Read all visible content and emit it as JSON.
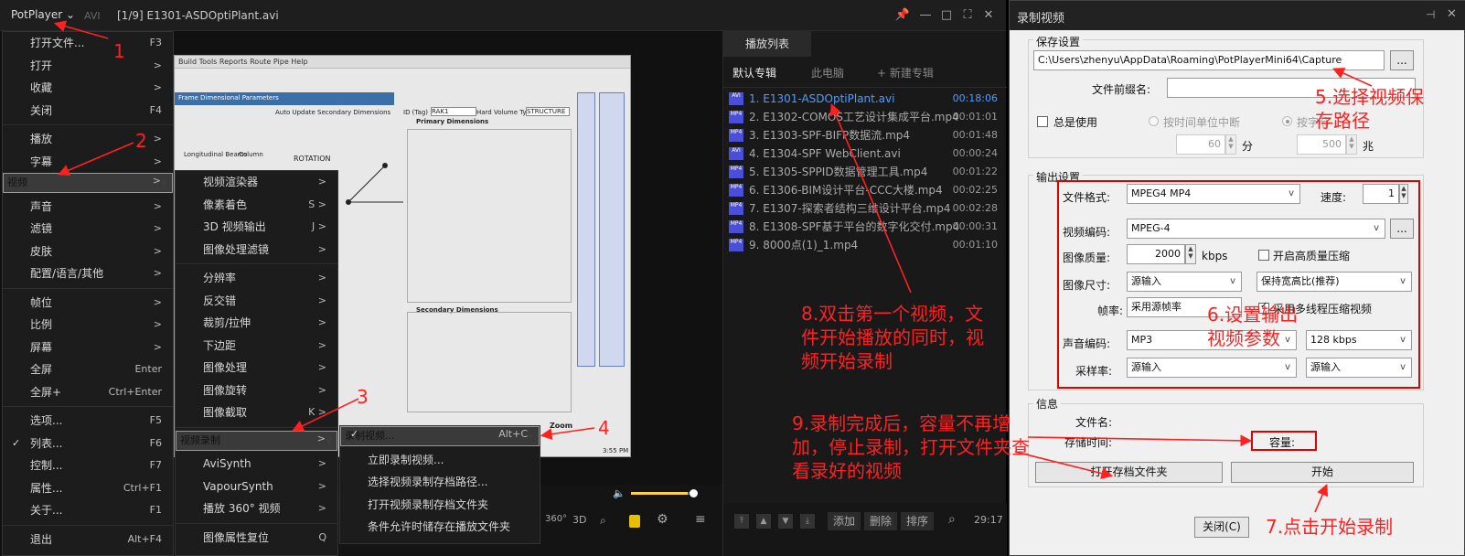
{
  "titlebar": {
    "brand": "PotPlayer",
    "format": "AVI",
    "filename": "[1/9] E1301-ASDOptiPlant.avi"
  },
  "main_menu": [
    {
      "label": "打开文件...",
      "sc": "F3"
    },
    {
      "label": "打开",
      "sc": ">"
    },
    {
      "label": "收藏",
      "sc": ">"
    },
    {
      "label": "关闭",
      "sc": "F4"
    },
    {
      "label": "播放",
      "sc": ">"
    },
    {
      "label": "字幕",
      "sc": ">"
    },
    {
      "label": "视频",
      "sc": ">"
    },
    {
      "label": "声音",
      "sc": ">"
    },
    {
      "label": "滤镜",
      "sc": ">"
    },
    {
      "label": "皮肤",
      "sc": ">"
    },
    {
      "label": "配置/语言/其他",
      "sc": ">"
    },
    {
      "label": "帧位",
      "sc": ">"
    },
    {
      "label": "比例",
      "sc": ">"
    },
    {
      "label": "屏幕",
      "sc": ">"
    },
    {
      "label": "全屏",
      "sc": "Enter"
    },
    {
      "label": "全屏+",
      "sc": "Ctrl+Enter"
    },
    {
      "label": "选项...",
      "sc": "F5"
    },
    {
      "label": "列表...",
      "sc": "F6"
    },
    {
      "label": "控制...",
      "sc": "F7"
    },
    {
      "label": "属性...",
      "sc": "Ctrl+F1"
    },
    {
      "label": "关于...",
      "sc": "F1"
    },
    {
      "label": "退出",
      "sc": "Alt+F4"
    }
  ],
  "video_menu": [
    {
      "label": "视频渲染器",
      "sc": ">"
    },
    {
      "label": "像素着色",
      "sc": "S >"
    },
    {
      "label": "3D 视频输出",
      "sc": "J >"
    },
    {
      "label": "图像处理滤镜",
      "sc": ">"
    },
    {
      "label": "分辨率",
      "sc": ">"
    },
    {
      "label": "反交错",
      "sc": ">"
    },
    {
      "label": "裁剪/拉伸",
      "sc": ">"
    },
    {
      "label": "下边距",
      "sc": ">"
    },
    {
      "label": "图像处理",
      "sc": ">"
    },
    {
      "label": "图像旋转",
      "sc": ">"
    },
    {
      "label": "图像截取",
      "sc": "K >"
    },
    {
      "label": "视频录制",
      "sc": ">"
    },
    {
      "label": "AviSynth",
      "sc": ">"
    },
    {
      "label": "VapourSynth",
      "sc": ">"
    },
    {
      "label": "播放 360° 视频",
      "sc": ">"
    },
    {
      "label": "图像属性复位",
      "sc": "Q"
    }
  ],
  "record_menu": [
    {
      "label": "录制视频...",
      "sc": "Alt+C"
    },
    {
      "label": "立即录制视频..."
    },
    {
      "label": "选择视频录制存档路径..."
    },
    {
      "label": "打开视频录制存档文件夹"
    },
    {
      "label": "条件允许时储存在播放文件夹"
    }
  ],
  "playlist": {
    "tab": "播放列表",
    "subtabs": [
      "默认专辑",
      "此电脑",
      "+ 新建专辑"
    ],
    "items": [
      {
        "icon": "AVI",
        "title": "1. E1301-ASDOptiPlant.avi",
        "dur": "00:18:06"
      },
      {
        "icon": "MP4",
        "title": "2. E1302-COMOS工艺设计集成平台.mp4",
        "dur": "00:01:01"
      },
      {
        "icon": "MP4",
        "title": "3. E1303-SPF-BIFP数据流.mp4",
        "dur": "00:01:48"
      },
      {
        "icon": "AVI",
        "title": "4. E1304-SPF WebClient.avi",
        "dur": "00:00:24"
      },
      {
        "icon": "MP4",
        "title": "5. E1305-SPPID数据管理工具.mp4",
        "dur": "00:01:22"
      },
      {
        "icon": "MP4",
        "title": "6. E1306-BIM设计平台-CCC大楼.mp4",
        "dur": "00:02:25"
      },
      {
        "icon": "MP4",
        "title": "7. E1307-探索者结构三维设计平台.mp4",
        "dur": "00:02:28"
      },
      {
        "icon": "MP4",
        "title": "8. E1308-SPF基于平台的数字化交付.mp4",
        "dur": "00:00:31"
      },
      {
        "icon": "MP4",
        "title": "9. 8000点(1)_1.mp4",
        "dur": "00:01:10"
      }
    ],
    "buttons": [
      "添加",
      "删除",
      "排序"
    ],
    "total": "29:17"
  },
  "controls": {
    "labels": [
      "360°",
      "3D"
    ]
  },
  "video_frame": {
    "menu": "Build Tools Reports Route Pipe Help",
    "panel_title": "Frame Dimensional Parameters",
    "auto_update": "Auto Update Secondary Dimensions",
    "id_label": "ID (Tag)",
    "id_value": "RAK1",
    "hv_label": "Hard Volume Type",
    "hv_value": "STRUCTURE",
    "primary": "Primary Dimensions",
    "rotation": "ROTATION",
    "longitudinal": "Longitudinal Beams",
    "column": "Column",
    "secondary": "Secondary Dimensions",
    "zoom": "Zoom",
    "time": "3:55 PM"
  },
  "record": {
    "title": "录制视频",
    "save_group": "保存设置",
    "path": "C:\\Users\\zhenyu\\AppData\\Roaming\\PotPlayerMini64\\Capture",
    "prefix_label": "文件前缀名:",
    "always_use": "总是使用",
    "by_time": "按时间单位中断",
    "by_size": "按字节",
    "time_val": "60",
    "time_unit": "分",
    "size_val": "500",
    "size_unit": "兆",
    "output_group": "输出设置",
    "format_label": "文件格式:",
    "format_val": "MPEG4 MP4",
    "speed_label": "速度:",
    "speed_val": "1",
    "vcodec_label": "视频编码:",
    "vcodec_val": "MPEG-4",
    "quality_label": "图像质量:",
    "quality_val": "2000",
    "quality_unit": "kbps",
    "hq_label": "开启高质量压缩",
    "size_label": "图像尺寸:",
    "size_sel": "源输入",
    "aspect_sel": "保持宽高比(推荐)",
    "fps_label": "帧率:",
    "fps_val": "采用源帧率",
    "mt_label": "采用多线程压缩视频",
    "acodec_label": "声音编码:",
    "acodec_val": "MP3",
    "abitrate_val": "128 kbps",
    "srate_label": "采样率:",
    "srate_val1": "源输入",
    "srate_val2": "源输入",
    "info_group": "信息",
    "fname_label": "文件名:",
    "stime_label": "存储时间:",
    "cap_label": "容量:",
    "open_folder": "打开存档文件夹",
    "start": "开始",
    "close": "关闭(C)"
  },
  "annotations": {
    "a1": "1",
    "a2": "2",
    "a3": "3",
    "a4": "4",
    "a5": "5.选择视频保存路径",
    "a6": "6.设置输出视频参数",
    "a7": "7.点击开始录制",
    "a8": "8.双击第一个视频，文件开始播放的同时，视频开始录制",
    "a9": "9.录制完成后，容量不再增加，停止录制，打开文件夹查看录好的视频"
  },
  "colors": {
    "accent": "#4b9eff",
    "annotation": "#ff2020",
    "icon": "#4a4fd8"
  }
}
